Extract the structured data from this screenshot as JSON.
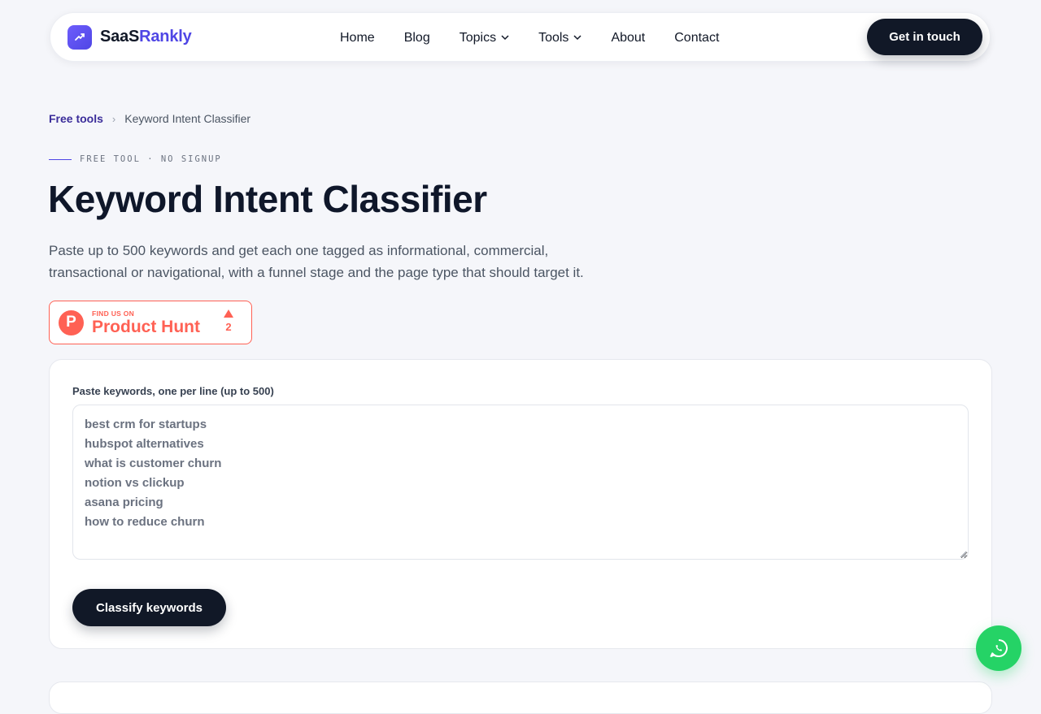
{
  "brand": {
    "name_part1": "SaaS",
    "name_part2": "Rankly",
    "logo_icon": "trending-up-icon",
    "accent": "#4f46e5"
  },
  "nav": {
    "items": [
      {
        "label": "Home"
      },
      {
        "label": "Blog"
      },
      {
        "label": "Topics",
        "dropdown": true
      },
      {
        "label": "Tools",
        "dropdown": true
      },
      {
        "label": "About"
      },
      {
        "label": "Contact"
      }
    ],
    "cta_label": "Get in touch"
  },
  "breadcrumb": {
    "parent": "Free tools",
    "separator": "›",
    "current": "Keyword Intent Classifier"
  },
  "hero": {
    "eyebrow": "FREE TOOL · NO SIGNUP",
    "title": "Keyword Intent Classifier",
    "description_line1": "Paste up to 500 keywords and get each one tagged as informational, commercial,",
    "description_line2": "transactional or navigational, with a funnel stage and the page type that should target it."
  },
  "product_hunt": {
    "small_label": "FIND US ON",
    "big_label": "Product Hunt",
    "logo_letter": "P",
    "votes": "2",
    "color": "#ff6154"
  },
  "form": {
    "label": "Paste keywords, one per line (up to 500)",
    "placeholder": "best crm for startups\nhubspot alternatives\nwhat is customer churn\nnotion vs clickup\nasana pricing\nhow to reduce churn",
    "submit_label": "Classify keywords"
  },
  "floating": {
    "icon": "whatsapp-icon",
    "color": "#25d366"
  }
}
